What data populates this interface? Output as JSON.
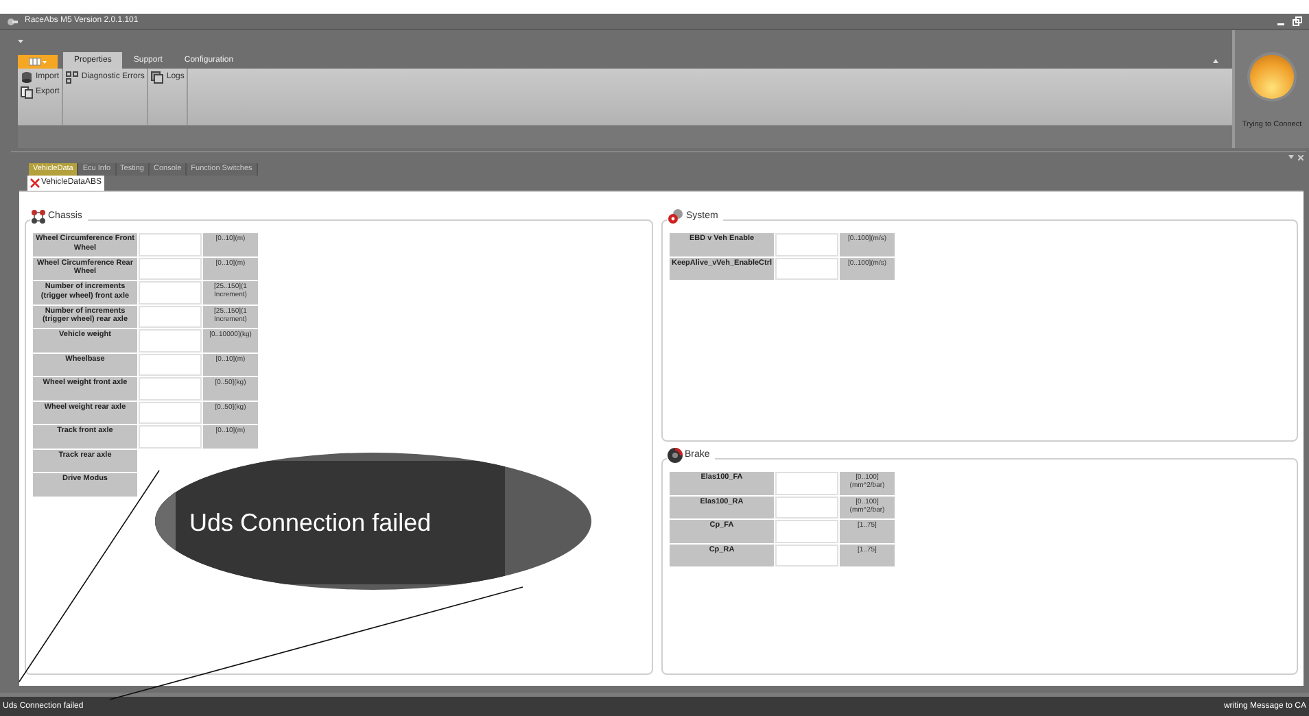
{
  "window": {
    "title": "RaceAbs M5 Version 2.0.1.101"
  },
  "ribbon": {
    "tabs": [
      {
        "label": "Properties",
        "selected": true
      },
      {
        "label": "Support",
        "selected": false
      },
      {
        "label": "Configuration",
        "selected": false
      }
    ],
    "groups": [
      {
        "items": [
          {
            "label": "Import",
            "kind": "database"
          },
          {
            "label": "Export",
            "kind": "export"
          }
        ]
      },
      {
        "items": [
          {
            "label": "Diagnostic Errors",
            "kind": "diagnostic"
          }
        ]
      },
      {
        "items": [
          {
            "label": "Logs",
            "kind": "logs"
          }
        ]
      }
    ]
  },
  "connection": {
    "status": "Trying to Connect"
  },
  "doc_tabs": [
    {
      "label": "VehicleData",
      "selected": true
    },
    {
      "label": "Ecu Info",
      "selected": false
    },
    {
      "label": "Testing",
      "selected": false
    },
    {
      "label": "Console",
      "selected": false
    },
    {
      "label": "Function Switches",
      "selected": false
    }
  ],
  "sub_tab": {
    "label": "VehicleDataABS"
  },
  "groups": [
    {
      "title": "Chassis",
      "kind": "chassis",
      "rows": [
        {
          "label": "Wheel Circumference Front Wheel",
          "range": "[0..10](m)"
        },
        {
          "label": "Wheel Circumference Rear Wheel",
          "range": "[0..10](m)"
        },
        {
          "label": "Number of increments (trigger wheel) front axle",
          "range": "[25..150](1 Increment)"
        },
        {
          "label": "Number of increments (trigger wheel) rear axle",
          "range": "[25..150](1 Increment)"
        },
        {
          "label": "Vehicle weight",
          "range": "[0..10000](kg)"
        },
        {
          "label": "Wheelbase",
          "range": "[0..10](m)"
        },
        {
          "label": "Wheel weight front axle",
          "range": "[0..50](kg)"
        },
        {
          "label": "Wheel weight rear axle",
          "range": "[0..50](kg)"
        },
        {
          "label": "Track front axle",
          "range": "[0..10](m)"
        },
        {
          "label": "Track rear axle"
        },
        {
          "label": "Drive Modus"
        }
      ]
    },
    {
      "title": "System",
      "kind": "system",
      "rows": [
        {
          "label": "EBD v Veh Enable",
          "range": "[0..100](m/s)"
        },
        {
          "label": "KeepAlive_vVeh_EnableCtrl",
          "range": "[0..100](m/s)"
        }
      ]
    },
    {
      "title": "Brake",
      "kind": "brake",
      "rows": [
        {
          "label": "Elas100_FA",
          "range": "[0..100](mm^2/bar)"
        },
        {
          "label": "Elas100_RA",
          "range": "[0..100](mm^2/bar)"
        },
        {
          "label": "Cp_FA",
          "range": "[1..75]"
        },
        {
          "label": "Cp_RA",
          "range": "[1..75]"
        }
      ]
    }
  ],
  "callout": {
    "text": "Uds Connection failed"
  },
  "status_bar": {
    "left": "Uds Connection failed",
    "right": "writing Message to CA"
  }
}
